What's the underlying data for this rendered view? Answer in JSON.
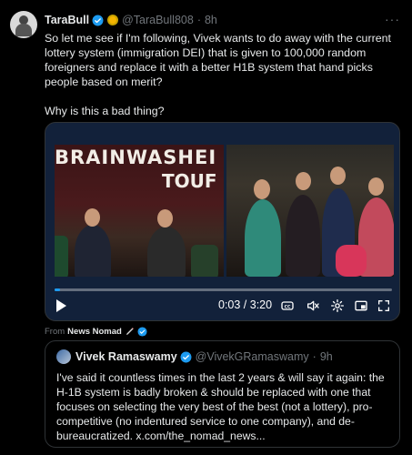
{
  "tweet": {
    "author_name": "TaraBull",
    "author_handle": "@TaraBull808",
    "separator": "·",
    "time": "8h",
    "more_label": "···",
    "paragraph1": "So let me see if I'm following, Vivek wants to do away with the current lottery system (immigration DEI) that is given to 100,000 random foreigners and replace it with a better H1B system that hand picks people based on merit?",
    "paragraph2": "Why is this a bad thing?"
  },
  "video": {
    "banner_text": "BRAINWASHEI",
    "banner_text2": "TOUF",
    "time_display": "0:03 / 3:20",
    "progress_fraction": 0.015
  },
  "attribution": {
    "prefix": "From",
    "source": "News Nomad"
  },
  "quote": {
    "author_name": "Vivek Ramaswamy",
    "author_handle": "@VivekGRamaswamy",
    "separator": "·",
    "time": "9h",
    "text": "I've said it countless times in the last 2 years & will say it again: the H-1B system is badly broken & should be replaced with one that focuses on selecting the very best of the best (not a lottery), pro-competitive (no indentured service to one company), and de-bureaucratized. x.com/the_nomad_news..."
  },
  "colors": {
    "background": "#000000",
    "text": "#e7e9ea",
    "secondary": "#71767b",
    "accent": "#1d9bf0",
    "border": "#2f3336"
  }
}
